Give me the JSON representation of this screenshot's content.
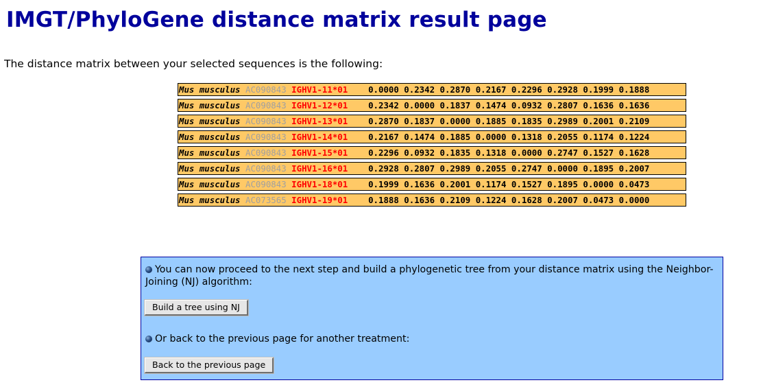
{
  "title": "IMGT/PhyloGene distance matrix result page",
  "intro": "The distance matrix between your selected sequences is the following:",
  "matrix": {
    "rows": [
      {
        "species": "Mus musculus",
        "accession": "AC090843",
        "gene": "IGHV1-11*01",
        "values": "0.0000 0.2342 0.2870 0.2167 0.2296 0.2928 0.1999 0.1888"
      },
      {
        "species": "Mus musculus",
        "accession": "AC090843",
        "gene": "IGHV1-12*01",
        "values": "0.2342 0.0000 0.1837 0.1474 0.0932 0.2807 0.1636 0.1636"
      },
      {
        "species": "Mus musculus",
        "accession": "AC090843",
        "gene": "IGHV1-13*01",
        "values": "0.2870 0.1837 0.0000 0.1885 0.1835 0.2989 0.2001 0.2109"
      },
      {
        "species": "Mus musculus",
        "accession": "AC090843",
        "gene": "IGHV1-14*01",
        "values": "0.2167 0.1474 0.1885 0.0000 0.1318 0.2055 0.1174 0.1224"
      },
      {
        "species": "Mus musculus",
        "accession": "AC090843",
        "gene": "IGHV1-15*01",
        "values": "0.2296 0.0932 0.1835 0.1318 0.0000 0.2747 0.1527 0.1628"
      },
      {
        "species": "Mus musculus",
        "accession": "AC090843",
        "gene": "IGHV1-16*01",
        "values": "0.2928 0.2807 0.2989 0.2055 0.2747 0.0000 0.1895 0.2007"
      },
      {
        "species": "Mus musculus",
        "accession": "AC090843",
        "gene": "IGHV1-18*01",
        "values": "0.1999 0.1636 0.2001 0.1174 0.1527 0.1895 0.0000 0.0473"
      },
      {
        "species": "Mus musculus",
        "accession": "AC073565",
        "gene": "IGHV1-19*01",
        "values": "0.1888 0.1636 0.2109 0.1224 0.1628 0.2007 0.0473 0.0000"
      }
    ]
  },
  "panel": {
    "nj_text": "You can now proceed to the next step and build a phylogenetic tree from your distance matrix using the Neighbor-Joining (NJ) algorithm:",
    "nj_button": "Build a tree using NJ",
    "back_text": "Or back to the previous page for another treatment:",
    "back_button": "Back to the previous page"
  },
  "colors": {
    "title": "#00009c",
    "row_background": "#ffc966",
    "accession": "#a0a0a0",
    "gene": "#ff0000",
    "panel_background": "#99ccff",
    "panel_border": "#0000a0"
  }
}
